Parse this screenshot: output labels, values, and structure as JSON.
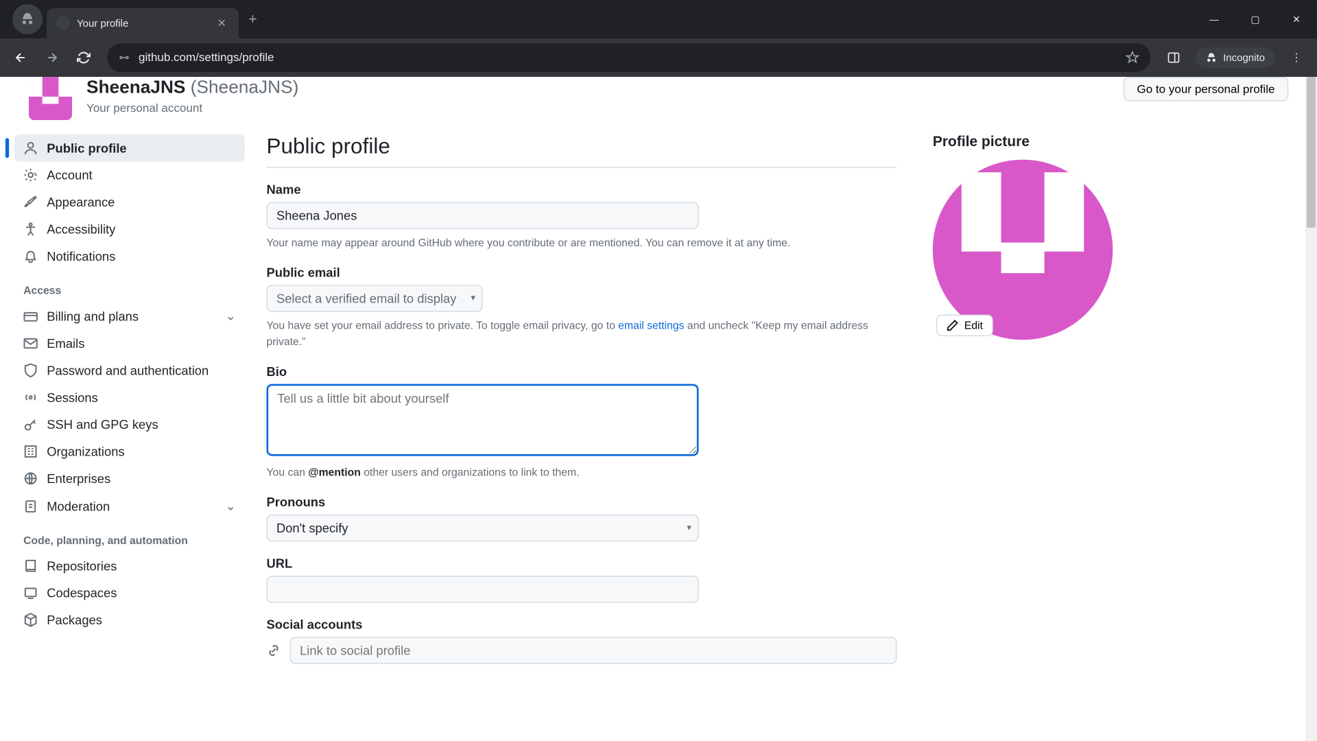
{
  "browser": {
    "tab_title": "Your profile",
    "url": "github.com/settings/profile",
    "incognito_label": "Incognito"
  },
  "header": {
    "username": "SheenaJNS",
    "display_suffix": "(SheenaJNS)",
    "subtitle": "Your personal account",
    "goto_button": "Go to your personal profile"
  },
  "sidebar": {
    "items_top": [
      {
        "label": "Public profile"
      },
      {
        "label": "Account"
      },
      {
        "label": "Appearance"
      },
      {
        "label": "Accessibility"
      },
      {
        "label": "Notifications"
      }
    ],
    "heading_access": "Access",
    "items_access": [
      {
        "label": "Billing and plans"
      },
      {
        "label": "Emails"
      },
      {
        "label": "Password and authentication"
      },
      {
        "label": "Sessions"
      },
      {
        "label": "SSH and GPG keys"
      },
      {
        "label": "Organizations"
      },
      {
        "label": "Enterprises"
      },
      {
        "label": "Moderation"
      }
    ],
    "heading_code": "Code, planning, and automation",
    "items_code": [
      {
        "label": "Repositories"
      },
      {
        "label": "Codespaces"
      },
      {
        "label": "Packages"
      }
    ]
  },
  "form": {
    "section_title": "Public profile",
    "name_label": "Name",
    "name_value": "Sheena Jones",
    "name_note": "Your name may appear around GitHub where you contribute or are mentioned. You can remove it at any time.",
    "email_label": "Public email",
    "email_placeholder": "Select a verified email to display",
    "email_note_pre": "You have set your email address to private. To toggle email privacy, go to ",
    "email_link": "email settings",
    "email_note_post": " and uncheck \"Keep my email address private.\"",
    "bio_label": "Bio",
    "bio_placeholder": "Tell us a little bit about yourself",
    "bio_note_pre": "You can ",
    "bio_mention": "@mention",
    "bio_note_post": " other users and organizations to link to them.",
    "pronouns_label": "Pronouns",
    "pronouns_value": "Don't specify",
    "url_label": "URL",
    "url_value": "",
    "social_label": "Social accounts",
    "social_placeholder": "Link to social profile"
  },
  "picture": {
    "heading": "Profile picture",
    "edit_label": "Edit"
  }
}
